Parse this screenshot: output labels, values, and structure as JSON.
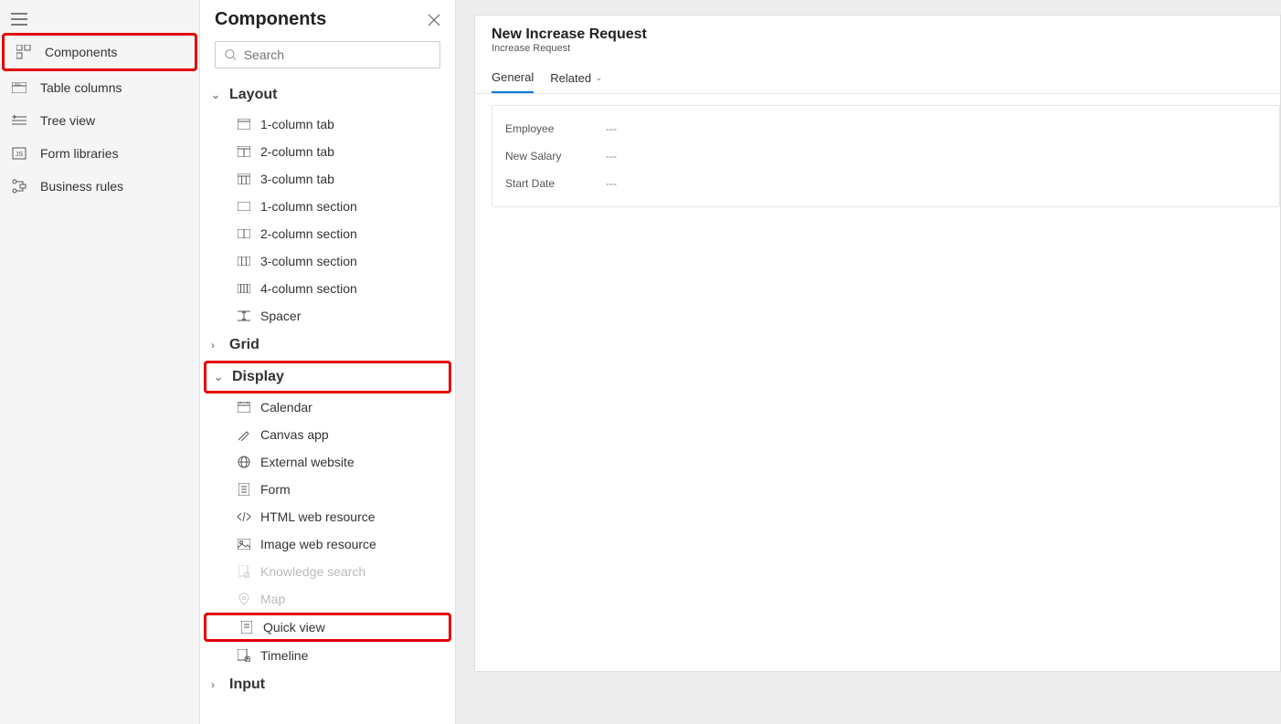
{
  "left_nav": {
    "items": [
      {
        "label": "Components"
      },
      {
        "label": "Table columns"
      },
      {
        "label": "Tree view"
      },
      {
        "label": "Form libraries"
      },
      {
        "label": "Business rules"
      }
    ]
  },
  "panel": {
    "title": "Components",
    "search_placeholder": "Search",
    "sections": {
      "layout": {
        "label": "Layout",
        "items": [
          {
            "label": "1-column tab"
          },
          {
            "label": "2-column tab"
          },
          {
            "label": "3-column tab"
          },
          {
            "label": "1-column section"
          },
          {
            "label": "2-column section"
          },
          {
            "label": "3-column section"
          },
          {
            "label": "4-column section"
          },
          {
            "label": "Spacer"
          }
        ]
      },
      "grid": {
        "label": "Grid"
      },
      "display": {
        "label": "Display",
        "items": [
          {
            "label": "Calendar"
          },
          {
            "label": "Canvas app"
          },
          {
            "label": "External website"
          },
          {
            "label": "Form"
          },
          {
            "label": "HTML web resource"
          },
          {
            "label": "Image web resource"
          },
          {
            "label": "Knowledge search"
          },
          {
            "label": "Map"
          },
          {
            "label": "Quick view"
          },
          {
            "label": "Timeline"
          }
        ]
      },
      "input": {
        "label": "Input"
      }
    }
  },
  "form": {
    "title": "New Increase Request",
    "subtitle": "Increase Request",
    "tabs": {
      "general": "General",
      "related": "Related"
    },
    "fields": [
      {
        "label": "Employee",
        "value": "---"
      },
      {
        "label": "New Salary",
        "value": "---"
      },
      {
        "label": "Start Date",
        "value": "---"
      }
    ]
  }
}
